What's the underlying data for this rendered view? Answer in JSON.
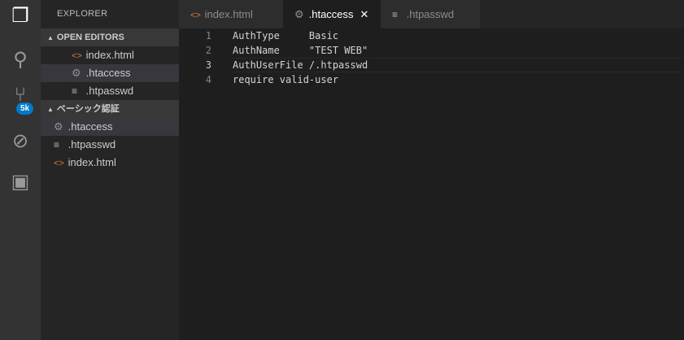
{
  "activity_bar": {
    "scm_badge": "5k"
  },
  "sidebar": {
    "title": "EXPLORER",
    "open_editors": {
      "label": "OPEN EDITORS",
      "items": [
        {
          "label": "index.html",
          "icon": "html"
        },
        {
          "label": ".htaccess",
          "icon": "gear"
        },
        {
          "label": ".htpasswd",
          "icon": "text"
        }
      ]
    },
    "folder": {
      "label": "ベーシック認証",
      "items": [
        {
          "label": ".htaccess",
          "icon": "gear"
        },
        {
          "label": ".htpasswd",
          "icon": "text"
        },
        {
          "label": "index.html",
          "icon": "html"
        }
      ]
    }
  },
  "tabs": [
    {
      "label": "index.html"
    },
    {
      "label": ".htaccess",
      "close": "✕"
    },
    {
      "label": ".htpasswd"
    }
  ],
  "editor": {
    "lines": [
      {
        "n": "1",
        "text": "AuthType     Basic"
      },
      {
        "n": "2",
        "text": "AuthName     \"TEST WEB\""
      },
      {
        "n": "3",
        "text": "AuthUserFile /.htpasswd"
      },
      {
        "n": "4",
        "text": "require valid-user"
      }
    ]
  }
}
